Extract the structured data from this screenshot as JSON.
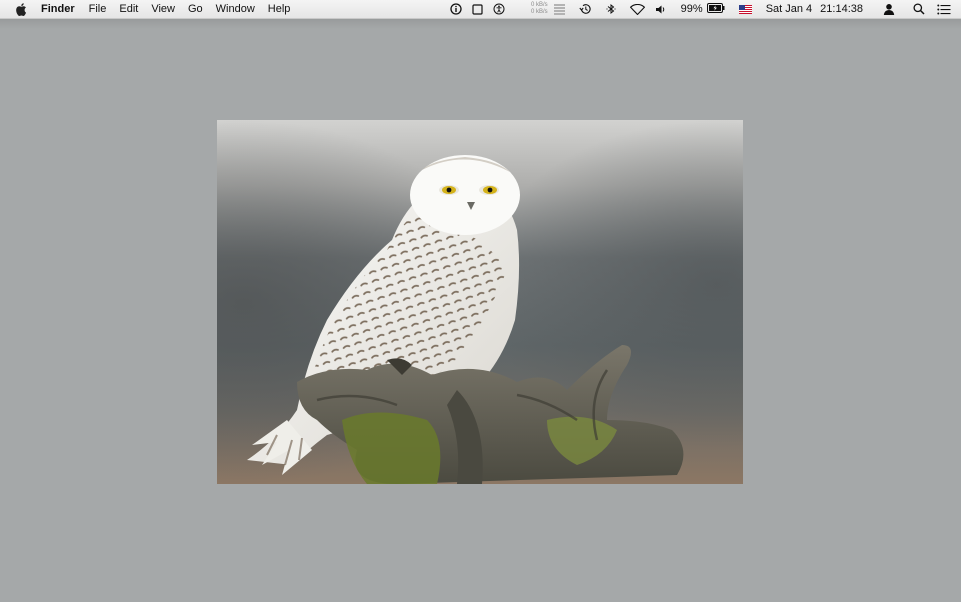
{
  "menubar": {
    "app_name": "Finder",
    "menus": [
      "File",
      "Edit",
      "View",
      "Go",
      "Window",
      "Help"
    ],
    "status": {
      "net_up": "0 kB/s",
      "net_down": "0 kB/s",
      "battery_percent": "99%",
      "date": "Sat Jan 4",
      "time": "21:14:38"
    },
    "icons": [
      "apple-icon",
      "info-icon",
      "square-icon",
      "accessibility-icon",
      "network-monitor-icon",
      "time-machine-icon",
      "bluetooth-icon",
      "wifi-icon",
      "volume-icon",
      "battery-icon",
      "flag-us-icon",
      "user-icon",
      "spotlight-search-icon",
      "notification-center-icon"
    ]
  },
  "photo": {
    "subject": "snowy-owl-photo",
    "colors": {
      "background_top": "#cfcfcd",
      "background_mid": "#6f7476",
      "ground": "#8c7764",
      "owl": "#f2f1ee",
      "wood": "#5d5a4d",
      "moss": "#6a7a2c"
    }
  },
  "desktop": {
    "background_color": "#a5a8a9"
  }
}
